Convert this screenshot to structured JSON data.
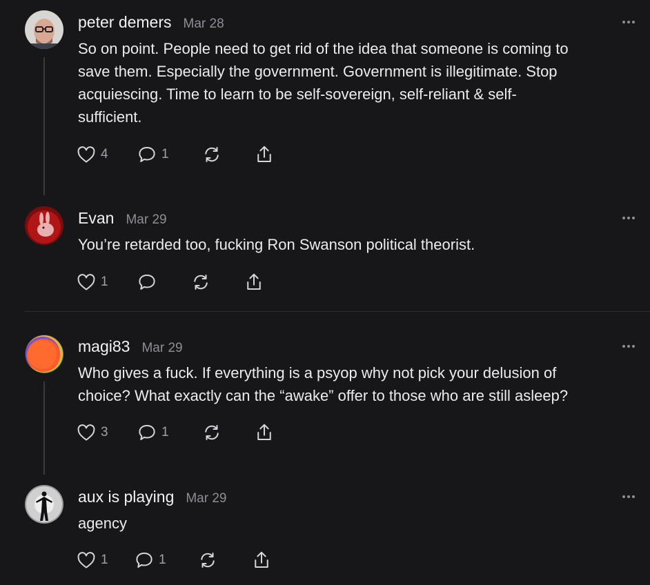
{
  "comments": [
    {
      "author": "peter demers",
      "date": "Mar 28",
      "lines": [
        "So on point. People need to get rid of the idea that someone is coming to",
        "save them. Especially the government. Government is illegitimate. Stop",
        "acquiescing. Time to learn to be self-sovereign, self-reliant & self-",
        "sufficient."
      ],
      "likes": "4",
      "replies": "1",
      "avatar": "bald-man-glasses-avatar"
    },
    {
      "author": "Evan",
      "date": "Mar 29",
      "lines": [
        "You’re retarded too, fucking Ron Swanson political theorist."
      ],
      "likes": "1",
      "avatar": "red-rabbit-avatar"
    },
    {
      "author": "magi83",
      "date": "Mar 29",
      "lines": [
        "Who gives a fuck. If everything is a psyop why not pick your delusion of",
        "choice? What exactly can the “awake” offer to those who are still asleep?"
      ],
      "likes": "3",
      "replies": "1",
      "avatar": "colorful-circle-avatar"
    },
    {
      "author": "aux is playing",
      "date": "Mar 29",
      "lines": [
        "agency"
      ],
      "likes": "1",
      "replies": "1",
      "avatar": "silhouette-figure-avatar"
    }
  ],
  "icons": {
    "like": "heart-icon",
    "reply": "speech-bubble-icon",
    "restack": "restack-icon",
    "share": "share-icon",
    "more": "more-dots-icon"
  },
  "colors": {
    "background": "#17171a",
    "text": "#ececee",
    "muted": "#8e8e93",
    "thread_line": "#3a3a3e"
  }
}
